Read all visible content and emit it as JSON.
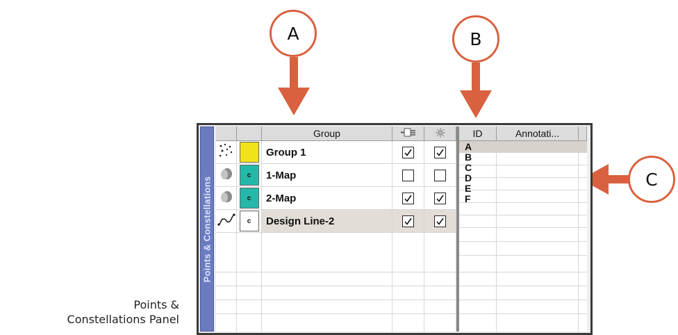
{
  "callouts": {
    "a": "A",
    "b": "B",
    "c": "C"
  },
  "caption": {
    "line1": "Points &",
    "line2": "Constellations Panel"
  },
  "panel": {
    "side_tab_label": "Points & Constellations",
    "left_columns": {
      "group": "Group"
    },
    "right_columns": {
      "id": "ID",
      "annotation": "Annotati..."
    },
    "rows": [
      {
        "name": "Group 1",
        "icon": "points-scatter-icon",
        "swatch_color": "#f2e21a",
        "swatch_label": "",
        "visible": true,
        "select": true
      },
      {
        "name": "1-Map",
        "icon": "map-blob-icon",
        "swatch_color": "#25b8a8",
        "swatch_label": "c",
        "visible": false,
        "select": false
      },
      {
        "name": "2-Map",
        "icon": "map-blob-icon",
        "swatch_color": "#25b8a8",
        "swatch_label": "c",
        "visible": true,
        "select": true
      },
      {
        "name": "Design Line-2",
        "icon": "design-line-icon",
        "swatch_color": "#ffffff",
        "swatch_label": "c",
        "visible": true,
        "select": true,
        "highlighted": true
      }
    ],
    "ids": [
      "A",
      "B",
      "C",
      "D",
      "E",
      "F"
    ],
    "selected_id": "A"
  },
  "colors": {
    "accent": "#d9613f",
    "tab": "#6b7bbf",
    "row_highlight": "#e2ddd6"
  }
}
